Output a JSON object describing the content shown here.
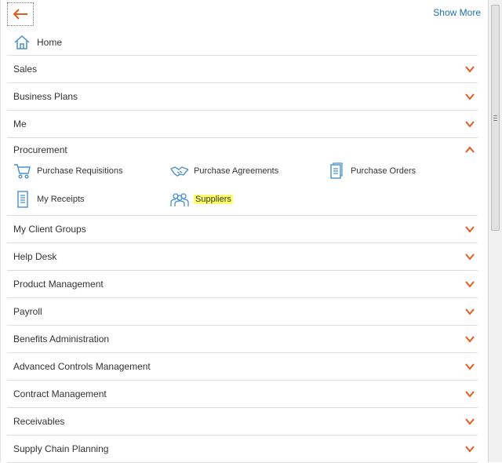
{
  "header": {
    "show_more_label": "Show More",
    "back_icon": "arrow-left-icon"
  },
  "home": {
    "label": "Home",
    "icon": "home-icon"
  },
  "nav_before": [
    "Sales",
    "Business Plans",
    "Me"
  ],
  "procurement": {
    "label": "Procurement",
    "tasks": [
      {
        "label": "Purchase Requisitions",
        "icon": "shopping-cart-icon"
      },
      {
        "label": "Purchase Agreements",
        "icon": "handshake-icon"
      },
      {
        "label": "Purchase Orders",
        "icon": "document-icon"
      },
      {
        "label": "My Receipts",
        "icon": "receipt-icon"
      },
      {
        "label": "Suppliers",
        "icon": "suppliers-group-icon"
      }
    ]
  },
  "nav_after": [
    "My Client Groups",
    "Help Desk",
    "Product Management",
    "Payroll",
    "Benefits Administration",
    "Advanced Controls Management",
    "Contract Management",
    "Receivables",
    "Supply Chain Planning"
  ],
  "colors": {
    "accent": "#e25c1f",
    "link": "#1f6fb2",
    "icon": "#4a90c8",
    "highlight": "#ffff66"
  }
}
